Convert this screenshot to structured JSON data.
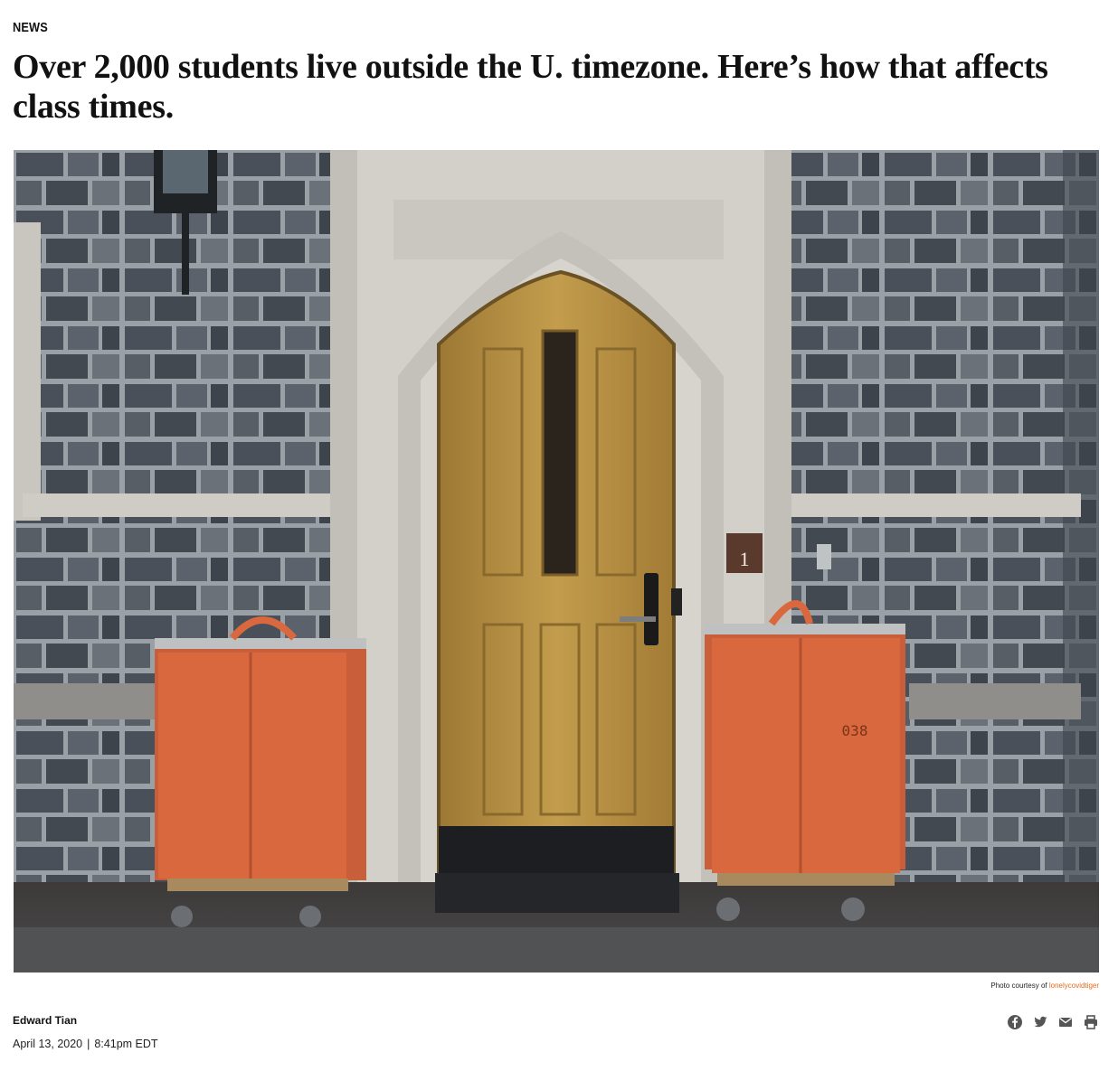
{
  "article": {
    "section": "NEWS",
    "headline": "Over 2,000 students live outside the U. timezone. Here’s how that affects class times."
  },
  "photo": {
    "caption_prefix": "Photo courtesy of",
    "caption_credit": "lonelycovidtiger",
    "room_number": "1",
    "bin_number": "038"
  },
  "byline": {
    "author": "Edward Tian",
    "date": "April 13, 2020",
    "separator": "|",
    "time": "8:41pm EDT"
  },
  "share": {
    "icons": [
      "facebook-icon",
      "twitter-icon",
      "email-icon",
      "print-icon"
    ]
  },
  "colors": {
    "accent": "#e86a1e",
    "text": "#111111",
    "bin_orange": "#d9683f",
    "door_wood": "#b8913f"
  }
}
